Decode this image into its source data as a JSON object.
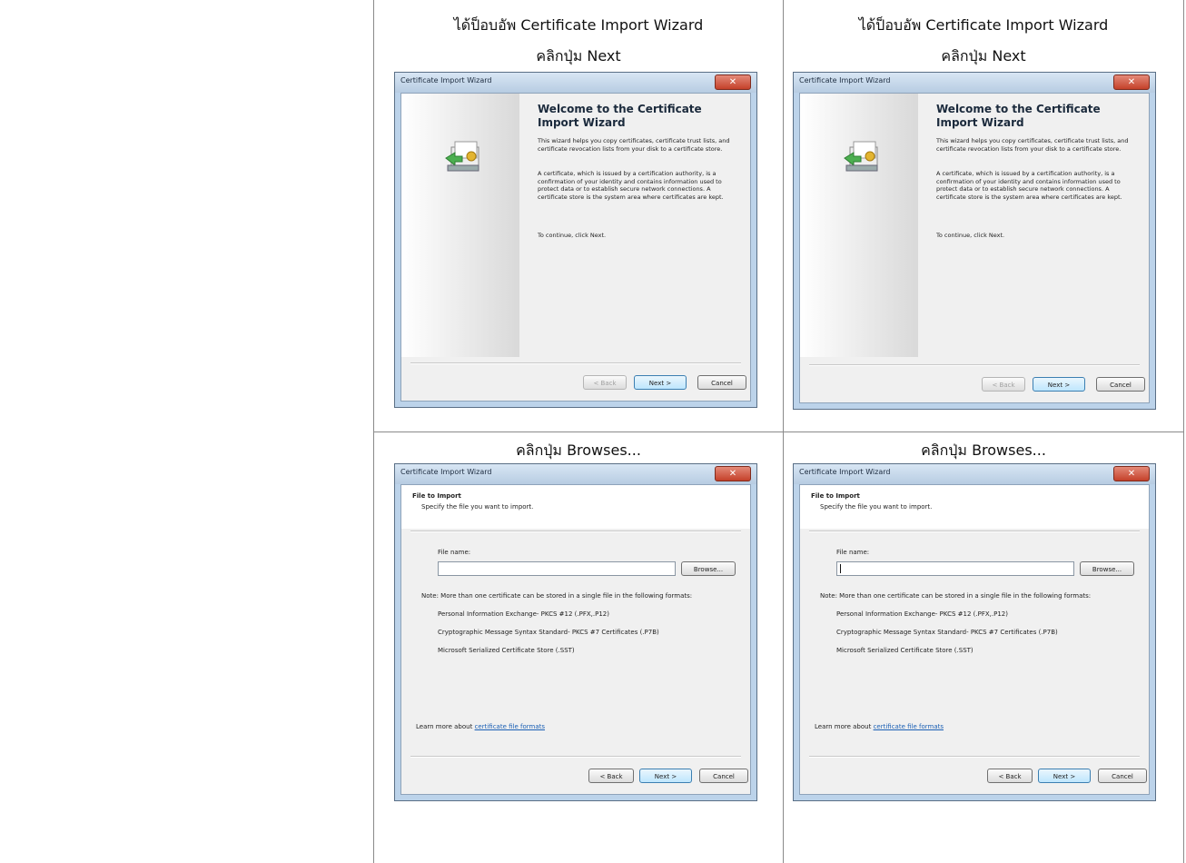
{
  "captions": {
    "row1": [
      "ได้ป็อบอัพ Certificate Import Wizard",
      "คลิกปุ่ม Next"
    ],
    "row2": "คลิกปุ่ม Browses..."
  },
  "welcome_dialog": {
    "title": "Certificate Import Wizard",
    "close": "✕",
    "heading": "Welcome to the Certificate Import Wizard",
    "para1": "This wizard helps you copy certificates, certificate trust lists, and certificate revocation lists from your disk to a certificate store.",
    "para2": "A certificate, which is issued by a certification authority, is a confirmation of your identity and contains information used to protect data or to establish secure network connections. A certificate store is the system area where certificates are kept.",
    "para3": "To continue, click Next.",
    "back": "< Back",
    "next": "Next >",
    "cancel": "Cancel"
  },
  "file_dialog": {
    "title": "Certificate Import Wizard",
    "close": "✕",
    "header": "File to Import",
    "subheader": "Specify the file you want to import.",
    "file_label": "File name:",
    "file_value": "",
    "browse": "Browse...",
    "note": "Note:  More than one certificate can be stored in a single file in the following formats:",
    "formats": [
      "Personal Information Exchange- PKCS #12 (.PFX,.P12)",
      "Cryptographic Message Syntax Standard- PKCS #7 Certificates (.P7B)",
      "Microsoft Serialized Certificate Store (.SST)"
    ],
    "learn_prefix": "Learn more about ",
    "learn_link": "certificate file formats",
    "back": "< Back",
    "next": "Next >",
    "cancel": "Cancel"
  }
}
